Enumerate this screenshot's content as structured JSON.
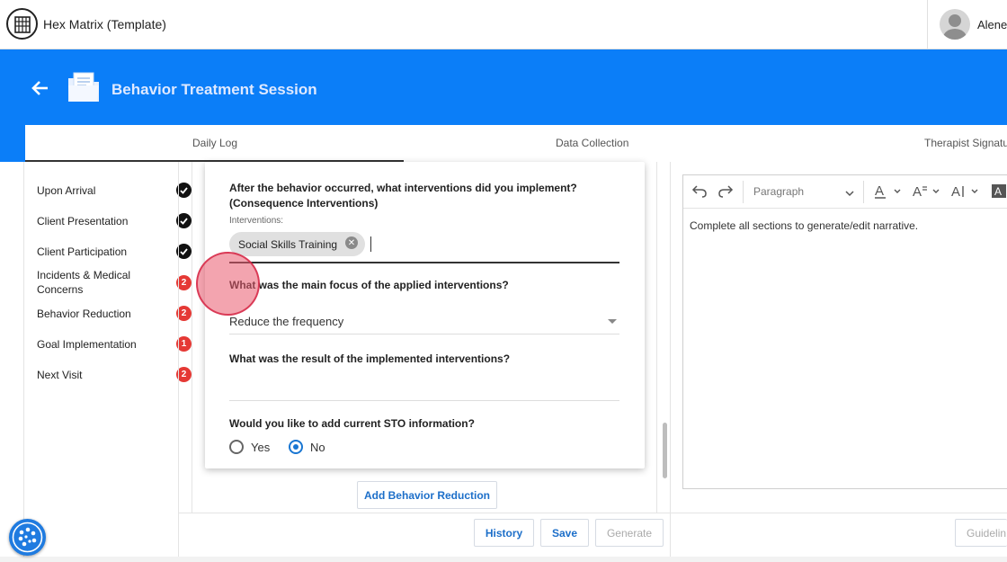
{
  "app": {
    "title": "Hex Matrix (Template)",
    "user_name": "Alene"
  },
  "header": {
    "page_title": "Behavior Treatment Session"
  },
  "tabs": [
    {
      "label": "Daily Log",
      "active": true
    },
    {
      "label": "Data Collection",
      "active": false
    },
    {
      "label": "Therapist Signatu",
      "active": false
    }
  ],
  "sidebar": {
    "items": [
      {
        "label": "Upon Arrival",
        "status": "complete"
      },
      {
        "label": "Client Presentation",
        "status": "complete"
      },
      {
        "label": "Client Participation",
        "status": "complete"
      },
      {
        "label": "Incidents & Medical Concerns",
        "status": "count",
        "count": "2"
      },
      {
        "label": "Behavior Reduction",
        "status": "count",
        "count": "2"
      },
      {
        "label": "Goal Implementation",
        "status": "count",
        "count": "1"
      },
      {
        "label": "Next Visit",
        "status": "count",
        "count": "2"
      }
    ]
  },
  "form": {
    "q_interventions": "After the behavior occurred, what interventions did you implement? (Consequence Interventions)",
    "interventions_label": "Interventions:",
    "chip": "Social Skills Training",
    "q_focus": "What was the main focus of the applied interventions?",
    "focus_value": "Reduce the frequency",
    "q_result": "What was the result of the implemented interventions?",
    "result_value": "",
    "q_sto": "Would you like to add current STO information?",
    "yes_label": "Yes",
    "no_label": "No",
    "selected": "No",
    "add_button": "Add Behavior Reduction"
  },
  "actions": {
    "history": "History",
    "save": "Save",
    "generate": "Generate",
    "guidelines": "Guidelin"
  },
  "editor": {
    "block_format": "Paragraph",
    "placeholder": "Complete all sections to generate/edit narrative."
  },
  "colors": {
    "brand_blue": "#0b7ef8",
    "badge_red": "#e53935",
    "link_blue": "#1d6fc9"
  }
}
